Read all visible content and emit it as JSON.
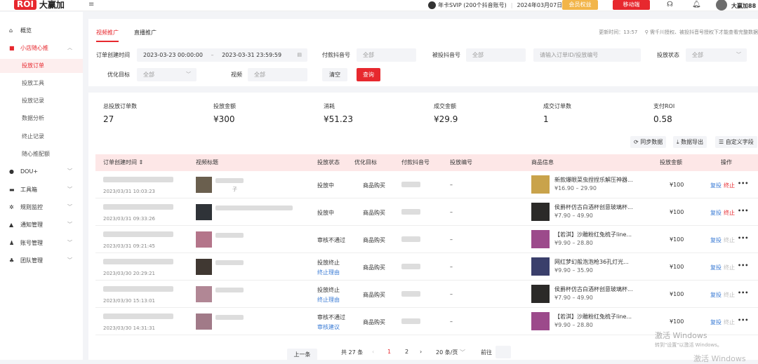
{
  "topbar": {
    "logo_mark": "ROI",
    "logo_text": "大赢加",
    "svip_text": "年卡SVIP (200个抖音账号)",
    "svip_expiry": "2024年03月07日到期",
    "vip_button": "会员权益",
    "mobile_button": "移动端",
    "username": "大赢加88"
  },
  "sidebar": {
    "items": [
      {
        "label": "概览",
        "icon": "home-icon"
      },
      {
        "label": "小店随心推",
        "icon": "shop-icon"
      },
      {
        "label": "投放订单"
      },
      {
        "label": "投放工具"
      },
      {
        "label": "投放记录"
      },
      {
        "label": "数据分析"
      },
      {
        "label": "终止记录"
      },
      {
        "label": "随心推配额"
      },
      {
        "label": "DOU+",
        "icon": "douplus-icon"
      },
      {
        "label": "工具箱",
        "icon": "toolbox-icon"
      },
      {
        "label": "规则监控",
        "icon": "gear-icon"
      },
      {
        "label": "通知管理",
        "icon": "bell-icon"
      },
      {
        "label": "账号管理",
        "icon": "user-icon"
      },
      {
        "label": "团队管理",
        "icon": "team-icon"
      }
    ]
  },
  "tabs": [
    "视频推广",
    "直播推广"
  ],
  "updated": "更新时间：13:57",
  "notice": "需千川授权、被投抖音号授权下才能查看完整数据",
  "filters": {
    "order_time_label": "订单创建时间",
    "date_start": "2023-03-23 00:00:00",
    "date_sep": "–",
    "date_end": "2023-03-31 23:59:59",
    "pay_account_label": "付款抖音号",
    "pay_account_value": "全部",
    "target_account_label": "被投抖音号",
    "target_account_value": "全部",
    "order_search_placeholder": "请输入订单ID/投放编号",
    "status_label": "投放状态",
    "status_value": "全部",
    "goal_label": "优化目标",
    "goal_value": "全部",
    "video_label": "视频",
    "video_value": "全部",
    "clear_button": "清空",
    "query_button": "查询"
  },
  "stats": [
    {
      "label": "总投放订单数",
      "value": "27"
    },
    {
      "label": "投放金额",
      "value": "¥300"
    },
    {
      "label": "消耗",
      "value": "¥51.23"
    },
    {
      "label": "成交金额",
      "value": "¥29.9"
    },
    {
      "label": "成交订单数",
      "value": "1"
    },
    {
      "label": "支付ROI",
      "value": "0.58"
    }
  ],
  "tools": {
    "sync": "同步数据",
    "export": "数据导出",
    "custom": "自定义字段"
  },
  "table": {
    "headers": [
      "订单创建时间",
      "视频标题",
      "投放状态",
      "优化目标",
      "付款抖音号",
      "投放编号",
      "商品信息",
      "投放金额",
      "操作"
    ],
    "rows": [
      {
        "time": "2023/03/31 10:03:23",
        "title_tail": "子",
        "status": "投放中",
        "status_link": "",
        "goal": "商品购买",
        "code": "–",
        "product": "新款爆眼菜虫捏捏乐解压神器...",
        "price": "¥16.90 – 29.90",
        "amount": "¥100",
        "a1": "复投",
        "a2": "终止",
        "a2_active": true
      },
      {
        "time": "2023/03/31 09:33:26",
        "title_tail": "",
        "status": "投放中",
        "status_link": "",
        "goal": "商品购买",
        "code": "–",
        "product": "侯爵杯仿古白酒杯创意玻璃杯...",
        "price": "¥7.90 – 49.90",
        "amount": "¥100",
        "a1": "复投",
        "a2": "终止",
        "a2_active": true
      },
      {
        "time": "2023/03/31 09:21:45",
        "title_tail": "",
        "status": "审核不通过",
        "status_link": "",
        "goal": "商品购买",
        "code": "–",
        "product": "【若淇】沙雕粉红兔梳子line...",
        "price": "¥9.90 – 28.80",
        "amount": "¥100",
        "a1": "复投",
        "a2": "终止",
        "a2_active": false
      },
      {
        "time": "2023/03/30 20:29:21",
        "title_tail": "",
        "status": "投放终止",
        "status_link": "终止理由",
        "goal": "商品购买",
        "code": "–",
        "product": "网红梦幻般泡泡枪36孔灯光...",
        "price": "¥9.90 – 35.90",
        "amount": "¥100",
        "a1": "复投",
        "a2": "终止",
        "a2_active": false
      },
      {
        "time": "2023/03/30 15:13:01",
        "title_tail": "",
        "status": "投放终止",
        "status_link": "终止理由",
        "goal": "商品购买",
        "code": "–",
        "product": "侯爵杯仿古白酒杯创意玻璃杯...",
        "price": "¥7.90 – 49.90",
        "amount": "¥100",
        "a1": "复投",
        "a2": "终止",
        "a2_active": false
      },
      {
        "time": "2023/03/30 14:31:31",
        "title_tail": "",
        "status": "审核不通过",
        "status_link": "审核建议",
        "goal": "商品购买",
        "code": "–",
        "product": "【若淇】沙雕粉红兔梳子line...",
        "price": "¥9.90 – 28.80",
        "amount": "¥100",
        "a1": "复投",
        "a2": "终止",
        "a2_active": false
      }
    ]
  },
  "pager": {
    "prev": "上一条",
    "total": "共 27 条",
    "page1": "1",
    "page2": "2",
    "per_page": "20 条/页",
    "goto": "前往"
  },
  "watermark": {
    "line1": "激活 Windows",
    "line2": "转到\"设置\"以激活 Windows。",
    "line3": "激活 Windows"
  },
  "colors": {
    "accent": "#e7282e",
    "vip": "#f2b54a",
    "link": "#3a7bd5"
  }
}
